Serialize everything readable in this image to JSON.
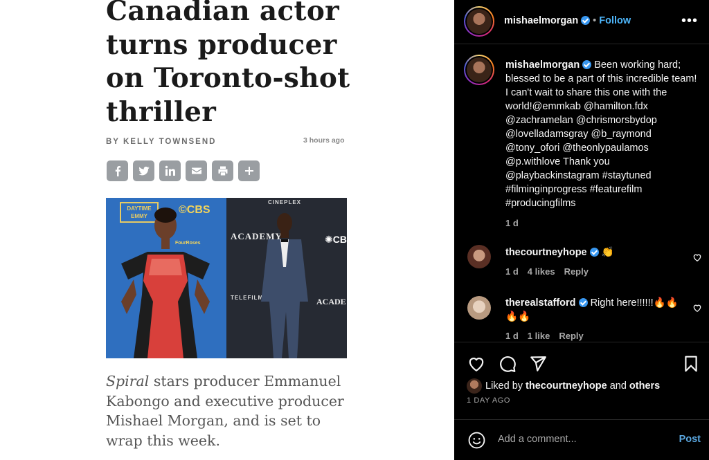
{
  "article": {
    "headline": "Canadian actor turns producer on Toronto-shot thriller",
    "byline": "BY KELLY TOWNSEND",
    "timestamp": "3 hours ago",
    "share_buttons": [
      "facebook-icon",
      "twitter-icon",
      "linkedin-icon",
      "email-icon",
      "print-icon",
      "plus-icon"
    ],
    "photo_logos": {
      "cbs": "©CBS",
      "daytime": "DAYTIME EMMY",
      "sponsor": "FourRoses",
      "cineplex": "CINEPLEX",
      "academy": "ACADEMY",
      "cbc": "✺CB",
      "telefilm": "TELEFILM",
      "academy2": "ACADE"
    },
    "caption_italic": "Spiral",
    "caption_rest": " stars producer Emmanuel Kabongo and executive producer Mishael Morgan, and is set to wrap this week."
  },
  "instagram": {
    "header": {
      "username": "mishaelmorgan",
      "separator": "•",
      "follow_label": "Follow"
    },
    "post_caption": {
      "username": "mishaelmorgan",
      "text": "Been working hard; blessed to be a part of this incredible team! I can't wait to share this one with the world!@emmkab @hamilton.fdx @zachramelan @chrismorsbydop @lovelladamsgray @b_raymond @tony_ofori @theonlypaulamos @p.withlove Thank you @playbackinstagram #staytuned #filminginprogress #featurefilm #producingfilms",
      "age": "1 d"
    },
    "comments": [
      {
        "username": "thecourtneyhope",
        "text": "👏",
        "age": "1 d",
        "likes": "4 likes",
        "reply": "Reply"
      },
      {
        "username": "therealstafford",
        "text": "Right here!!!!!!🔥🔥🔥🔥",
        "age": "1 d",
        "likes": "1 like",
        "reply": "Reply"
      }
    ],
    "liked_by_prefix": "Liked by ",
    "liked_by_user": "thecourtneyhope",
    "liked_by_and": " and ",
    "liked_by_others": "others",
    "posted_ago": "1 DAY AGO",
    "comment_placeholder": "Add a comment...",
    "post_label": "Post"
  },
  "colors": {
    "instagram_bg": "#000000",
    "link_blue": "#4db5f9",
    "verified_blue": "#3897f0",
    "share_button_gray": "#9a9ea2"
  }
}
